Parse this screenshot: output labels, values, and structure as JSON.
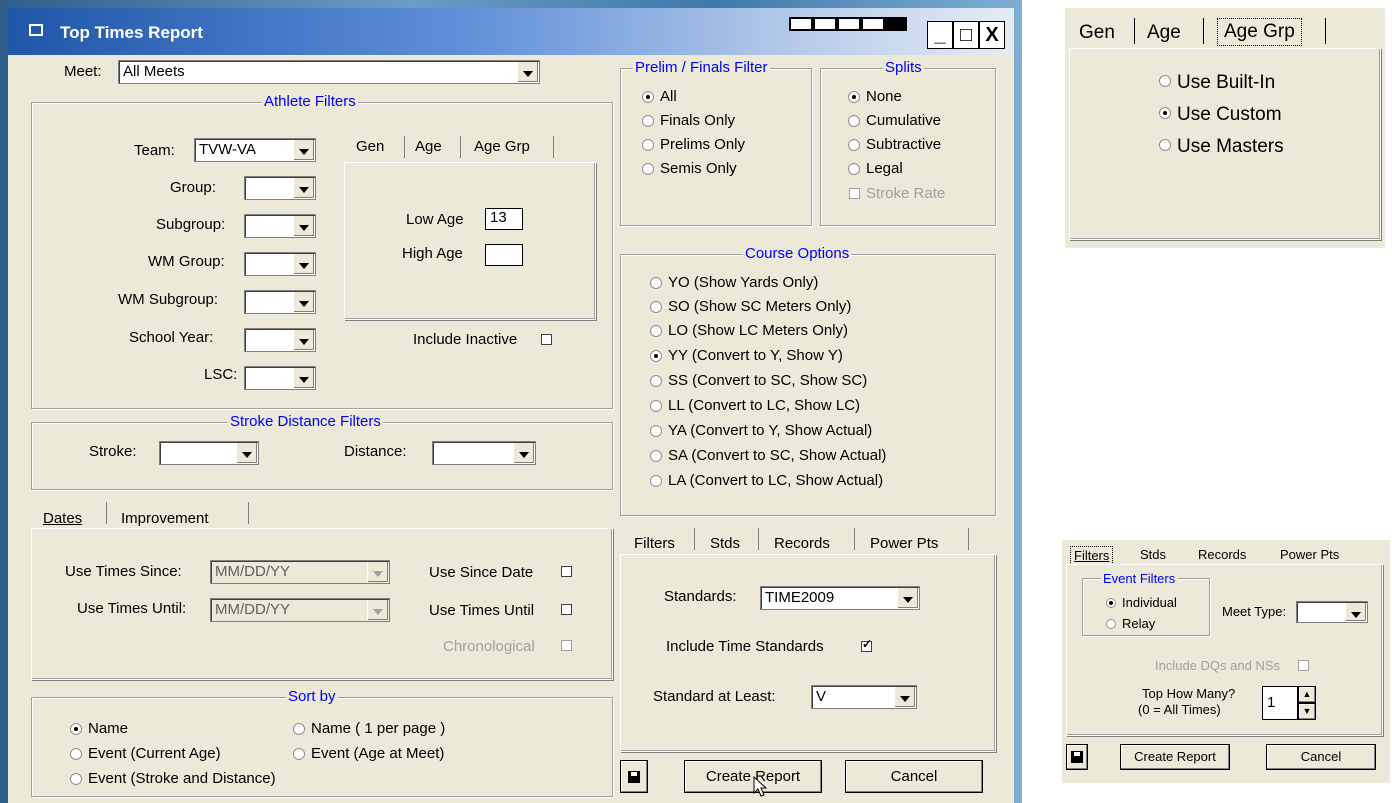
{
  "window": {
    "title": "Top Times Report",
    "minimize": "_",
    "maximize": "□",
    "close": "X"
  },
  "meet": {
    "label": "Meet:",
    "value": "All Meets"
  },
  "athlete_filters": {
    "title": "Athlete Filters",
    "team": {
      "label": "Team:",
      "value": "TVW-VA"
    },
    "group_label": "Group:",
    "subgroup_label": "Subgroup:",
    "wm_group_label": "WM Group:",
    "wm_subgroup_label": "WM Subgroup:",
    "school_year_label": "School Year:",
    "lsc_label": "LSC:",
    "tabs": [
      "Gen",
      "Age",
      "Age Grp"
    ],
    "low_age_label": "Low Age",
    "low_age_value": "13",
    "high_age_label": "High Age",
    "high_age_value": "",
    "include_inactive": "Include Inactive"
  },
  "stroke_distance": {
    "title": "Stroke Distance Filters",
    "stroke_label": "Stroke:",
    "distance_label": "Distance:"
  },
  "dates": {
    "tabs": [
      "Dates",
      "Improvement"
    ],
    "since_label": "Use Times Since:",
    "since_value": "MM/DD/YY",
    "until_label": "Use Times Until:",
    "until_value": "MM/DD/YY",
    "use_since_date": "Use Since Date",
    "use_times_until": "Use Times Until",
    "chronological": "Chronological"
  },
  "sort_by": {
    "title": "Sort by",
    "options": [
      "Name",
      "Name ( 1 per page )",
      "Event (Current Age)",
      "Event  (Age at Meet)",
      "Event (Stroke and Distance)"
    ]
  },
  "prelim_finals": {
    "title": "Prelim / Finals Filter",
    "options": [
      "All",
      "Finals Only",
      "Prelims Only",
      "Semis Only"
    ]
  },
  "splits": {
    "title": "Splits",
    "options": [
      "None",
      "Cumulative",
      "Subtractive",
      "Legal"
    ],
    "stroke_rate": "Stroke Rate"
  },
  "course_options": {
    "title": "Course Options",
    "options": [
      "YO (Show Yards Only)",
      "SO (Show SC Meters Only)",
      "LO (Show LC Meters Only)",
      "YY (Convert to Y, Show Y)",
      "SS (Convert to SC, Show SC)",
      "LL (Convert to LC, Show LC)",
      "YA (Convert to Y, Show Actual)",
      "SA (Convert to SC, Show Actual)",
      "LA (Convert to LC, Show Actual)"
    ]
  },
  "bottom_tabs": [
    "Filters",
    "Stds",
    "Records",
    "Power Pts"
  ],
  "standards": {
    "label": "Standards:",
    "value": "TIME2009",
    "include": "Include Time Standards",
    "at_least_label": "Standard at Least:",
    "at_least_value": "V"
  },
  "buttons": {
    "create": "Create Report",
    "cancel": "Cancel"
  },
  "inset_age_grp": {
    "tabs": [
      "Gen",
      "Age",
      "Age Grp"
    ],
    "options": [
      "Use Built-In",
      "Use Custom",
      "Use Masters"
    ]
  },
  "inset_filters": {
    "tabs": [
      "Filters",
      "Stds",
      "Records",
      "Power Pts"
    ],
    "event_filters_title": "Event Filters",
    "event_options": [
      "Individual",
      "Relay"
    ],
    "meet_type_label": "Meet Type:",
    "include_dqs": "Include DQs and NSs",
    "top_how_many": "Top How Many?",
    "all_times_note": "(0 = All Times)",
    "top_value": "1",
    "create": "Create Report",
    "cancel": "Cancel"
  }
}
